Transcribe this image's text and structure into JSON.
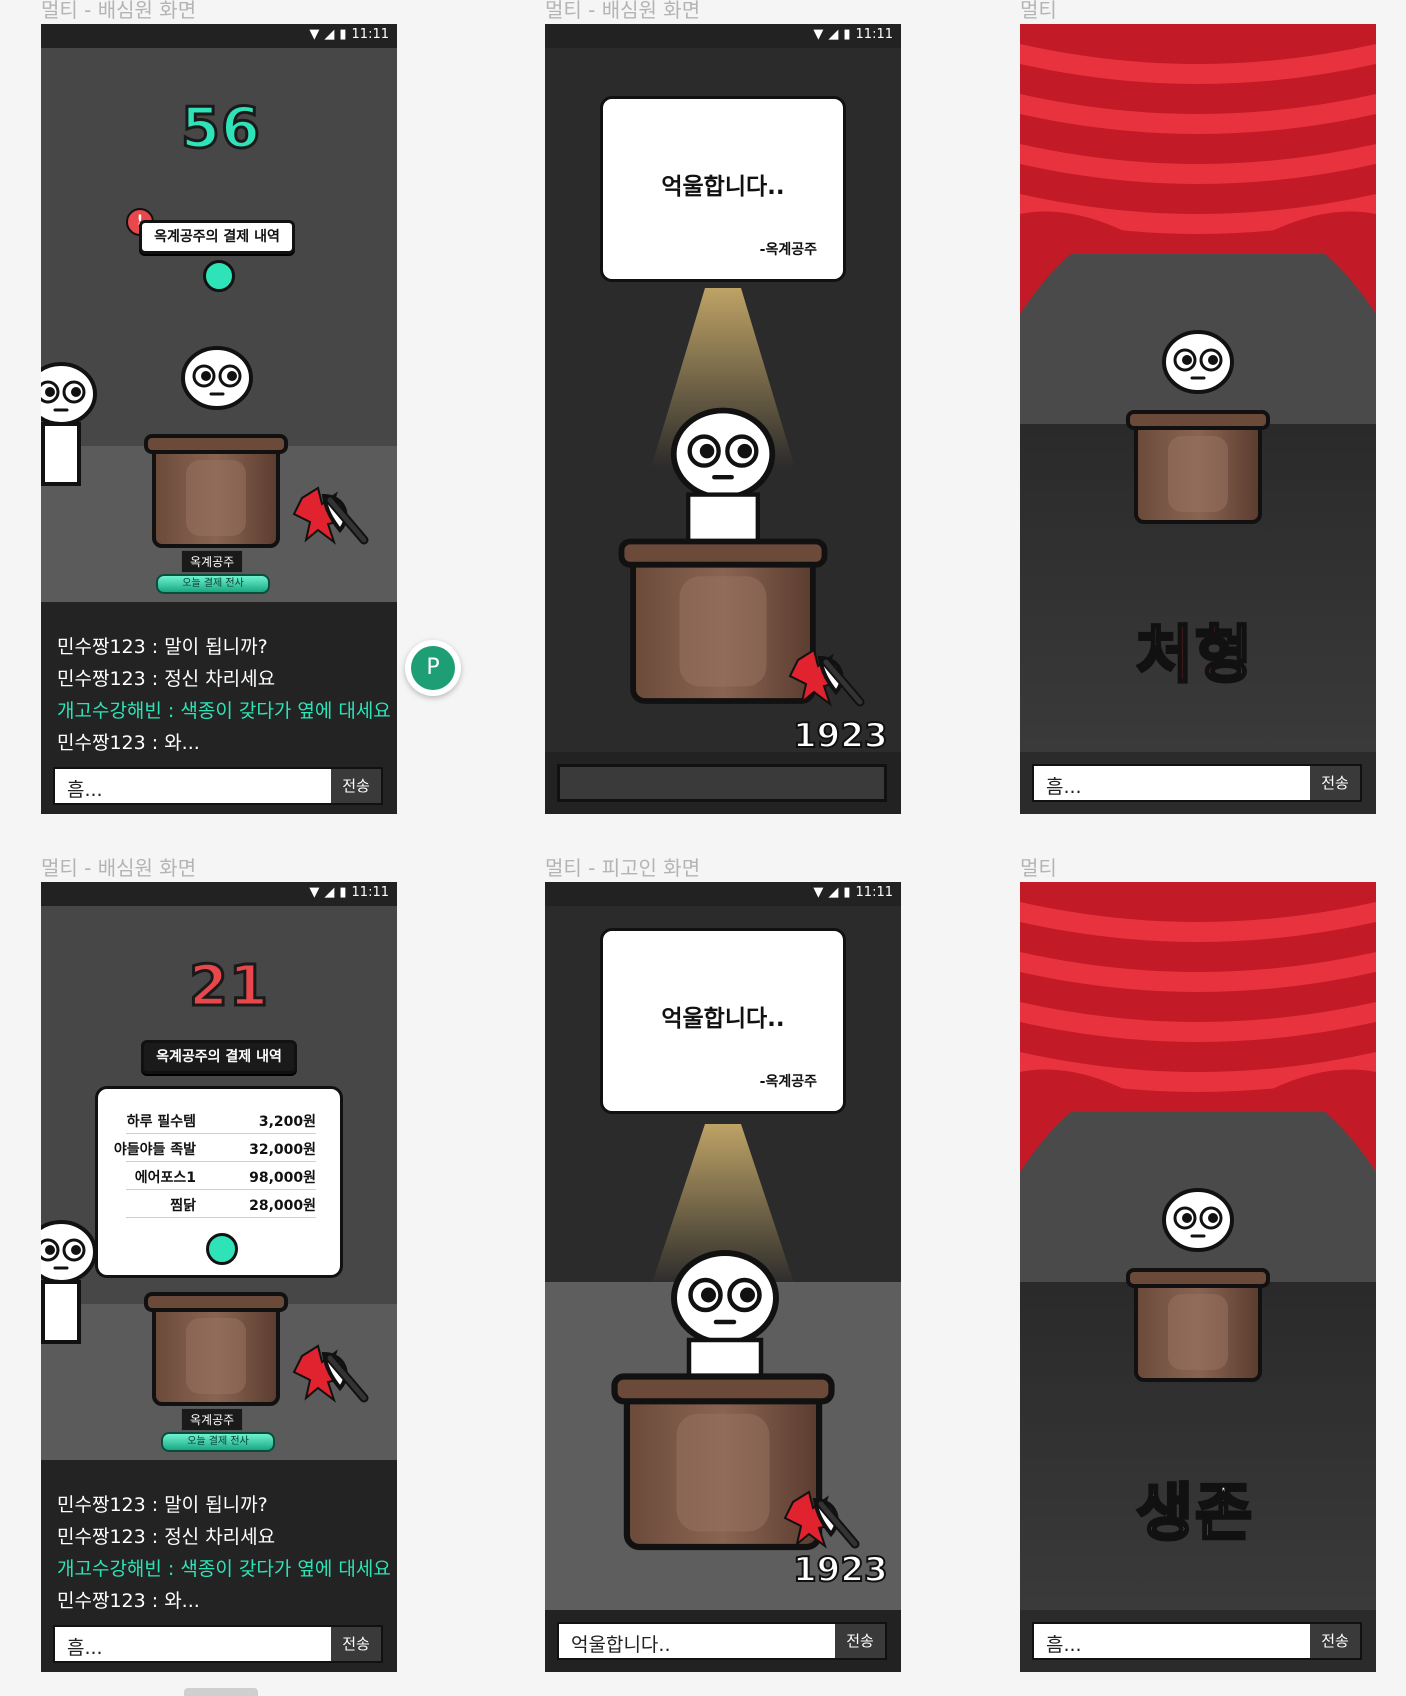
{
  "frame_labels": {
    "f1": "멀티 - 배심원 화면",
    "f2": "멀티 - 배심원 화면",
    "f3": "멀티",
    "f4": "멀티 - 배심원 화면",
    "f5": "멀티 - 피고인 화면",
    "f6": "멀티"
  },
  "status": {
    "time": "11:11"
  },
  "jury1": {
    "timer": "56",
    "payment_label": "옥계공주의 결제 내역",
    "name": "옥계공주",
    "badge": "오늘 결제 전사"
  },
  "jury2": {
    "timer": "21",
    "payment_label": "옥계공주의 결제 내역",
    "name": "옥계공주",
    "badge": "오늘 결제 전사",
    "items": [
      {
        "name": "하루 필수템",
        "price": "3,200원"
      },
      {
        "name": "야들야들 족발",
        "price": "32,000원"
      },
      {
        "name": "에어포스1",
        "price": "98,000원"
      },
      {
        "name": "찜닭",
        "price": "28,000원"
      }
    ]
  },
  "chat": [
    {
      "user": "민수짱123 :",
      "msg": "말이 됩니까?",
      "highlight": false
    },
    {
      "user": "민수짱123 :",
      "msg": "정신 차리세요",
      "highlight": false
    },
    {
      "user": "개고수강해빈 :",
      "msg": "색종이 갖다가 옆에 대세요",
      "highlight": true
    },
    {
      "user": "민수짱123 :",
      "msg": "와...",
      "highlight": false
    }
  ],
  "input": {
    "value": "흠...",
    "send": "전송"
  },
  "defendant": {
    "speech": "억울합니다..",
    "speech_by": "-옥계공주",
    "count": "1923",
    "input_value": "억울합니다..",
    "send": "전송"
  },
  "result": {
    "execution": "처형",
    "survival": "생존",
    "input_value": "흠...",
    "send": "전송"
  },
  "avatar_button": "P",
  "colors": {
    "timer_green": "#2ee3b7",
    "timer_red": "#e8474c",
    "curtain_red": "#d21f2b",
    "chat_highlight": "#2ee3b7"
  }
}
